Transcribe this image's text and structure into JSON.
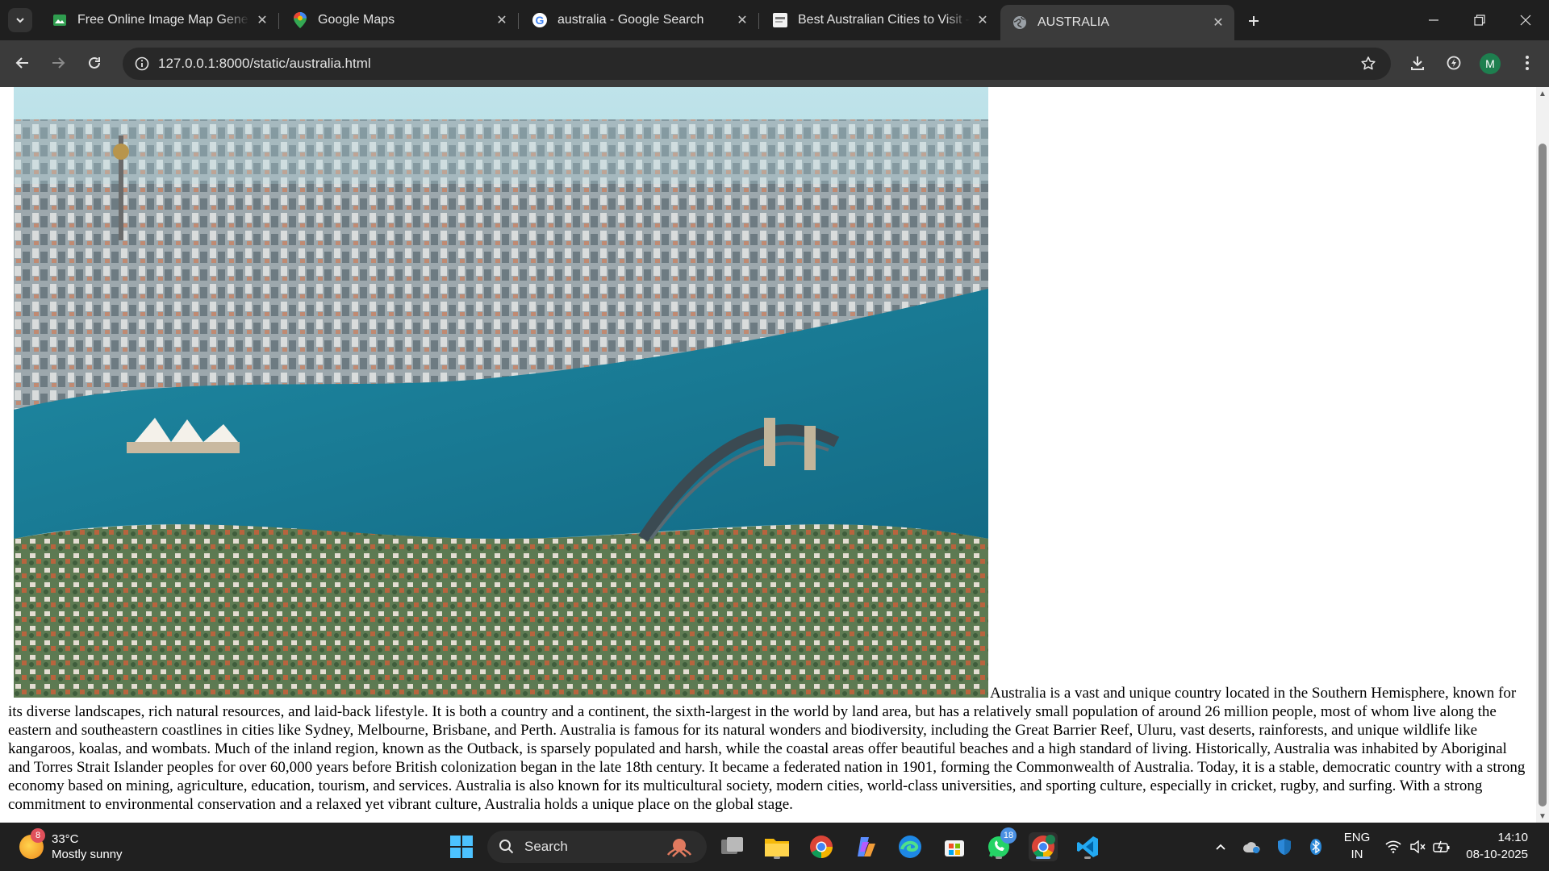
{
  "tabs": [
    {
      "title": "Free Online Image Map Genera",
      "favicon": "image-map-icon",
      "active": false
    },
    {
      "title": "Google Maps",
      "favicon": "google-maps-icon",
      "active": false
    },
    {
      "title": "australia - Google Search",
      "favicon": "google-icon",
      "active": false
    },
    {
      "title": "Best Australian Cities to Visit - E",
      "favicon": "site-icon",
      "active": false
    },
    {
      "title": "AUSTRALIA",
      "favicon": "globe-icon",
      "active": true
    }
  ],
  "toolbar": {
    "url": "127.0.0.1:8000/static/australia.html",
    "profile_initial": "M"
  },
  "page": {
    "image_alt": "Aerial view of Sydney Harbour",
    "paragraph": "Australia is a vast and unique country located in the Southern Hemisphere, known for its diverse landscapes, rich natural resources, and laid-back lifestyle. It is both a country and a continent, the sixth-largest in the world by land area, but has a relatively small population of around 26 million people, most of whom live along the eastern and southeastern coastlines in cities like Sydney, Melbourne, Brisbane, and Perth. Australia is famous for its natural wonders and biodiversity, including the Great Barrier Reef, Uluru, vast deserts, rainforests, and unique wildlife like kangaroos, koalas, and wombats. Much of the inland region, known as the Outback, is sparsely populated and harsh, while the coastal areas offer beautiful beaches and a high standard of living. Historically, Australia was inhabited by Aboriginal and Torres Strait Islander peoples for over 60,000 years before British colonization began in the late 18th century. It became a federated nation in 1901, forming the Commonwealth of Australia. Today, it is a stable, democratic country with a strong economy based on mining, agriculture, education, tourism, and services. Australia is also known for its multicultural society, modern cities, world-class universities, and sporting culture, especially in cricket, rugby, and surfing. With a strong commitment to environmental conservation and a relaxed yet vibrant culture, Australia holds a unique place on the global stage."
  },
  "taskbar": {
    "weather_badge": "8",
    "temperature": "33°C",
    "condition": "Mostly sunny",
    "search_label": "Search",
    "whatsapp_badge": "18",
    "lang_line1": "ENG",
    "lang_line2": "IN",
    "time": "14:10",
    "date": "08-10-2025"
  },
  "colors": {
    "browser_frame": "#1f1f1f",
    "active_tab": "#3b3b3b",
    "taskbar": "#202020",
    "accent": "#7ab7ff"
  }
}
